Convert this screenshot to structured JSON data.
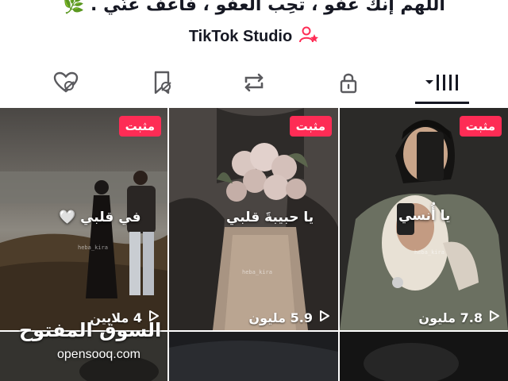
{
  "profile": {
    "bio": "اللهم إنك عفو ، تحِب العفو ، فاعف عنّي . 🌿",
    "studio_label": "TikTok Studio"
  },
  "tabs": [
    {
      "name": "liked-videos",
      "icon": "heart-eye-off-icon",
      "active": false
    },
    {
      "name": "favorites",
      "icon": "bookmark-eye-off-icon",
      "active": false
    },
    {
      "name": "reposts",
      "icon": "repost-icon",
      "active": false
    },
    {
      "name": "private",
      "icon": "lock-icon",
      "active": false
    },
    {
      "name": "videos",
      "icon": "grid-dropdown-icon",
      "active": true
    }
  ],
  "videos": [
    {
      "pinned_label": "مثبت",
      "views": "4 ملايين",
      "overlay": "في قلبي 🤍",
      "handle": "heba_kira"
    },
    {
      "pinned_label": "مثبت",
      "views": "5.9 مليون",
      "overlay": "يا حبيبةَ قلبي",
      "handle": "heba_kira"
    },
    {
      "pinned_label": "مثبت",
      "views": "7.8 مليون",
      "overlay": "يا أُنسي",
      "handle": "heba_kira"
    }
  ],
  "watermark": {
    "arabic": "السوق المفتوح",
    "latin": "opensooq.com"
  },
  "colors": {
    "pin_badge": "#fe2c55",
    "studio_icon": "#fe2c55",
    "text": "#161823"
  }
}
